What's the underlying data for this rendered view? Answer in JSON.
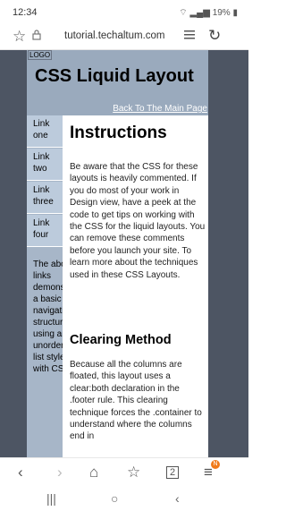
{
  "status": {
    "time": "12:34",
    "battery": "19%"
  },
  "browser": {
    "url": "tutorial.techaltum.com"
  },
  "page": {
    "logo": "LOGO",
    "title": "CSS Liquid Layout",
    "back_link": "Back To The Main Page",
    "nav": [
      "Link one",
      "Link two",
      "Link three",
      "Link four"
    ],
    "sidebar_text": "The above links demonstrate a basic navigational structure using an unordered list styled with CSS.",
    "instructions_heading": "Instructions",
    "instructions_text": "Be aware that the CSS for these layouts is heavily commented. If you do most of your work in Design view, have a peek at the code to get tips on working with the CSS for the liquid layouts. You can remove these comments before you launch your site. To learn more about the techniques used in these CSS Layouts.",
    "clearing_heading": "Clearing Method",
    "clearing_text": "Because all the columns are floated, this layout uses a clear:both declaration in the .footer rule. This clearing technique forces the .container to understand where the columns end in"
  },
  "bottom_nav": {
    "tab_count": "2",
    "badge": "N"
  },
  "colors": {
    "header": "#9aaabd",
    "sidebar": "#a7b6c8",
    "nav_item": "#bccbdc",
    "page_bg": "#4d5563",
    "badge": "#f07a1a"
  },
  "icons": [
    "bookmark-star-icon",
    "lock-icon",
    "reader-mode-icon",
    "reload-icon",
    "back-icon",
    "forward-icon",
    "home-icon",
    "bookmarks-icon",
    "tabs-icon",
    "menu-icon"
  ]
}
